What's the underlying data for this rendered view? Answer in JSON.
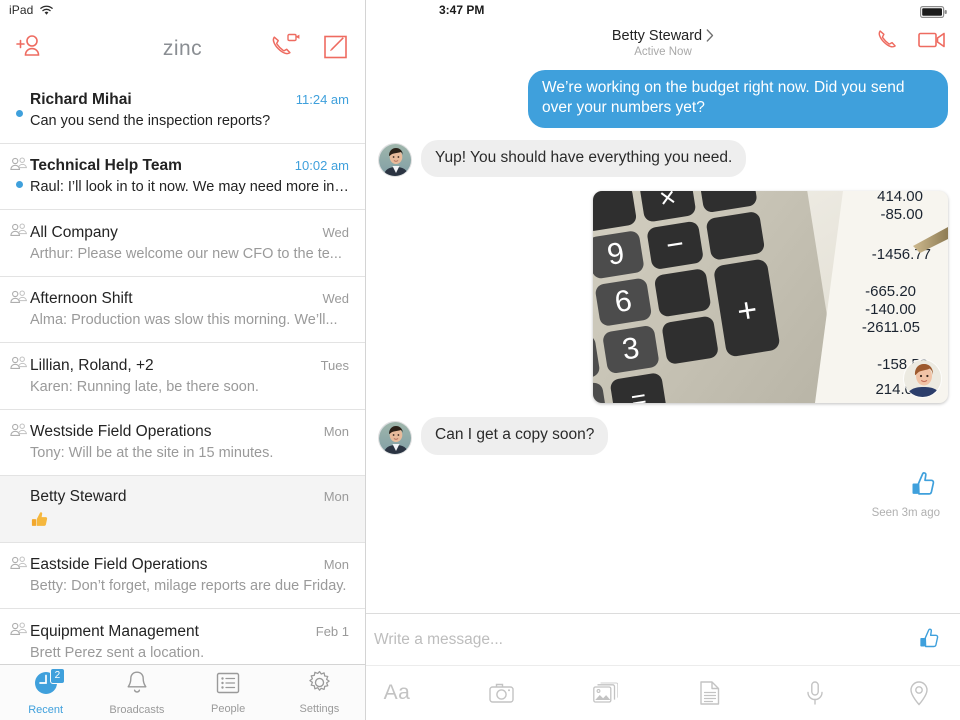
{
  "status_bar": {
    "device_label": "iPad",
    "wifi_icon": "wifi-icon",
    "time": "3:47 PM",
    "battery_icon": "battery-full-icon"
  },
  "left_pane": {
    "nav": {
      "add_contact_icon": "add-person-icon",
      "brand": "zinc",
      "call_icon": "phone-video-call-icon",
      "compose_icon": "compose-icon"
    },
    "conversations": [
      {
        "title": "Richard Mihai",
        "time": "11:24 am",
        "preview": "Can you send the inspection reports?",
        "unread": true,
        "group": false,
        "selected": false,
        "time_accent": true,
        "emoji": ""
      },
      {
        "title": "Technical Help Team",
        "time": "10:02 am",
        "preview": "Raul: I’ll look in to it now. We may need more info...",
        "unread": true,
        "group": true,
        "selected": false,
        "time_accent": true,
        "emoji": ""
      },
      {
        "title": "All Company",
        "time": "Wed",
        "preview": "Arthur: Please welcome our new CFO to the te...",
        "unread": false,
        "group": true,
        "selected": false,
        "time_accent": false,
        "emoji": ""
      },
      {
        "title": "Afternoon Shift",
        "time": "Wed",
        "preview": "Alma: Production was slow this morning. We’ll...",
        "unread": false,
        "group": true,
        "selected": false,
        "time_accent": false,
        "emoji": ""
      },
      {
        "title": "Lillian, Roland, +2",
        "time": "Tues",
        "preview": "Karen: Running late, be there soon.",
        "unread": false,
        "group": true,
        "selected": false,
        "time_accent": false,
        "emoji": ""
      },
      {
        "title": "Westside Field Operations",
        "time": "Mon",
        "preview": "Tony: Will be at the site in 15 minutes.",
        "unread": false,
        "group": true,
        "selected": false,
        "time_accent": false,
        "emoji": ""
      },
      {
        "title": "Betty Steward",
        "time": "Mon",
        "preview": "",
        "unread": false,
        "group": false,
        "selected": true,
        "time_accent": false,
        "emoji": "thumbs-up-emoji"
      },
      {
        "title": "Eastside Field Operations",
        "time": "Mon",
        "preview": "Betty: Don’t forget, milage reports are due Friday.",
        "unread": false,
        "group": true,
        "selected": false,
        "time_accent": false,
        "emoji": ""
      },
      {
        "title": "Equipment Management",
        "time": "Feb 1",
        "preview": "Brett Perez sent a location.",
        "unread": false,
        "group": true,
        "selected": false,
        "time_accent": false,
        "emoji": ""
      }
    ],
    "tabs": [
      {
        "label": "Recent",
        "icon": "clock-icon",
        "active": true,
        "badge": "2"
      },
      {
        "label": "Broadcasts",
        "icon": "bell-icon",
        "active": false,
        "badge": ""
      },
      {
        "label": "People",
        "icon": "list-icon",
        "active": false,
        "badge": ""
      },
      {
        "label": "Settings",
        "icon": "gear-icon",
        "active": false,
        "badge": ""
      }
    ]
  },
  "chat": {
    "header": {
      "title": "Betty Steward",
      "chevron_icon": "chevron-right-icon",
      "subtitle": "Active Now",
      "call_icon": "phone-icon",
      "video_icon": "video-camera-icon"
    },
    "messages": [
      {
        "direction": "out",
        "type": "text",
        "text": "We’re working on the budget right now. Did you send over your numbers yet?"
      },
      {
        "direction": "in",
        "type": "text",
        "text": "Yup! You should have everything you need.",
        "avatar": "betty-avatar"
      },
      {
        "direction": "out",
        "type": "image",
        "alt": "photo-of-calculator-and-ledger",
        "reaction_avatar": "reaction-avatar"
      },
      {
        "direction": "in",
        "type": "text",
        "text": "Can I get a copy soon?",
        "avatar": "betty-avatar"
      },
      {
        "direction": "out",
        "type": "sticker",
        "sticker": "thumbs-up-sticker",
        "status": "Seen 3m ago"
      }
    ],
    "composer": {
      "placeholder": "Write a message...",
      "input_value": "",
      "thumb_icon": "thumbs-up-icon",
      "tools": [
        {
          "label": "Aa",
          "icon": "text-format-icon"
        },
        {
          "label": "",
          "icon": "camera-icon"
        },
        {
          "label": "",
          "icon": "photos-icon"
        },
        {
          "label": "",
          "icon": "document-icon"
        },
        {
          "label": "",
          "icon": "microphone-icon"
        },
        {
          "label": "",
          "icon": "location-pin-icon"
        }
      ]
    }
  },
  "colors": {
    "accent_blue": "#3fa0dc",
    "accent_red": "#ee6b60",
    "bubble_in": "#eeeeee",
    "text_muted": "#9a9a9a"
  }
}
